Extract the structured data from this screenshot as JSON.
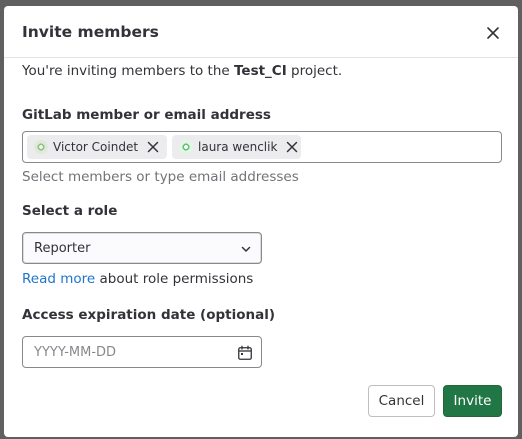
{
  "modal": {
    "title": "Invite members",
    "intro_prefix": "You're inviting members to the ",
    "project_name": "Test_CI",
    "intro_suffix": " project."
  },
  "members": {
    "label": "GitLab member or email address",
    "tokens": [
      {
        "name": "Victor Coindet",
        "avatar_color": "#7fb07a"
      },
      {
        "name": "laura wenclik",
        "avatar_color": "#7fc97a"
      }
    ],
    "help": "Select members or type email addresses"
  },
  "role": {
    "label": "Select a role",
    "selected": "Reporter",
    "read_more_link": "Read more",
    "read_more_suffix": " about role permissions"
  },
  "expiration": {
    "label": "Access expiration date (optional)",
    "placeholder": "YYYY-MM-DD"
  },
  "footer": {
    "cancel_label": "Cancel",
    "invite_label": "Invite"
  },
  "colors": {
    "primary_button": "#217645",
    "link": "#1f75cb",
    "backdrop": "#616061"
  },
  "icons": {
    "close": "close-icon",
    "token_remove": "close-icon",
    "select_chevron": "chevron-down-icon",
    "calendar": "calendar-icon"
  }
}
